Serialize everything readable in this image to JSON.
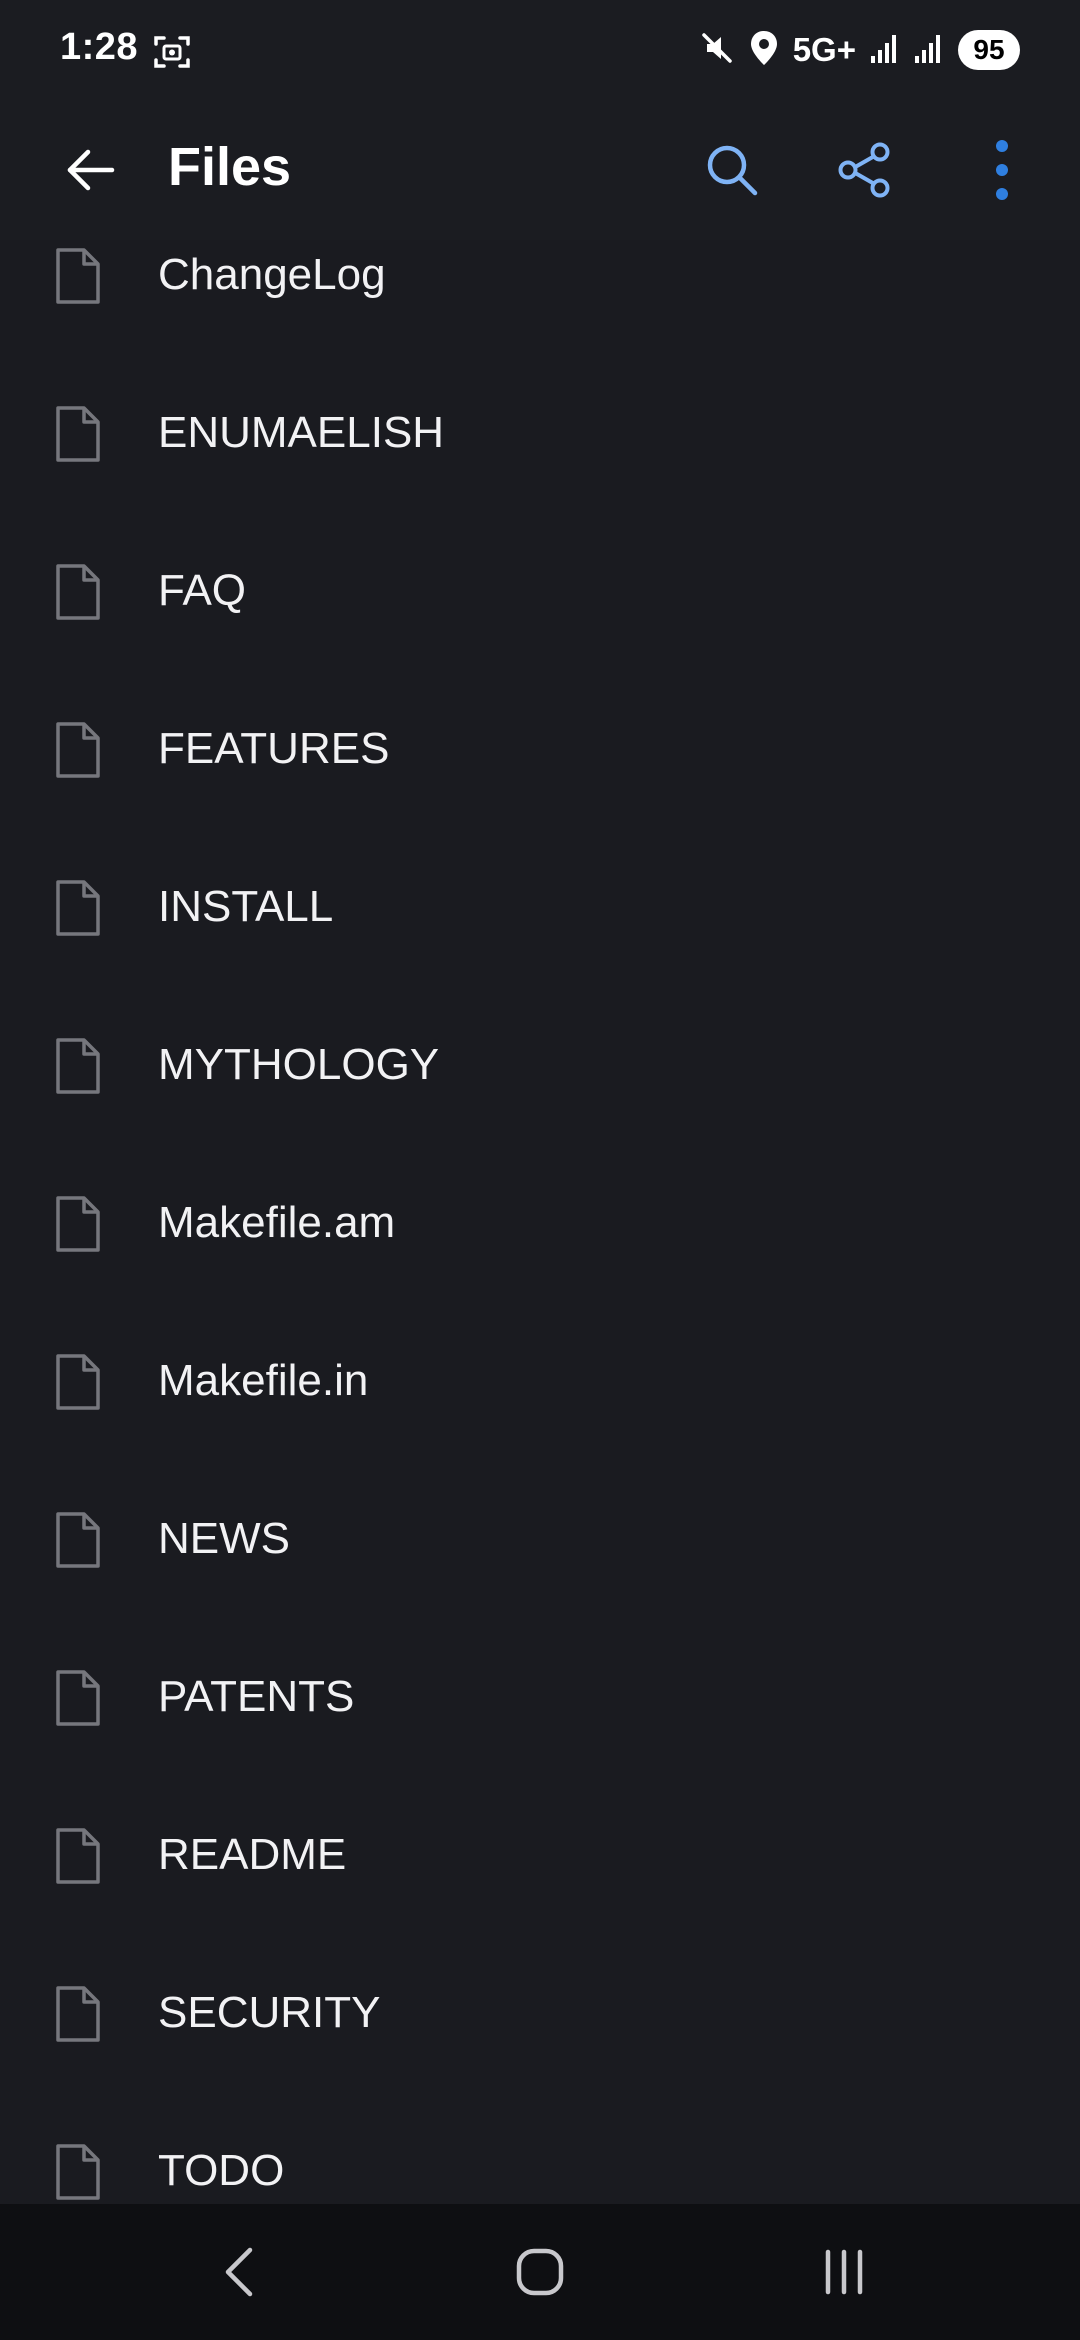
{
  "status_bar": {
    "time": "1:28",
    "network": "5G+",
    "battery": "95",
    "icons": [
      "screenshot-icon",
      "mute-icon",
      "location-icon",
      "signal-icon",
      "signal-icon"
    ]
  },
  "app_bar": {
    "title": "Files",
    "icons": [
      "back-arrow-icon",
      "search-icon",
      "share-icon",
      "more-vert-icon"
    ],
    "accent_color": "#7fb3f5",
    "more_color": "#2f7fe0"
  },
  "files": [
    {
      "name": "ChangeLog"
    },
    {
      "name": "ENUMAELISH"
    },
    {
      "name": "FAQ"
    },
    {
      "name": "FEATURES"
    },
    {
      "name": "INSTALL"
    },
    {
      "name": "MYTHOLOGY"
    },
    {
      "name": "Makefile.am"
    },
    {
      "name": "Makefile.in"
    },
    {
      "name": "NEWS"
    },
    {
      "name": "PATENTS"
    },
    {
      "name": "README"
    },
    {
      "name": "SECURITY"
    },
    {
      "name": "TODO"
    }
  ],
  "file_icon": "file-icon",
  "nav_bar": {
    "icons": [
      "nav-back-icon",
      "nav-home-icon",
      "nav-recents-icon"
    ]
  }
}
